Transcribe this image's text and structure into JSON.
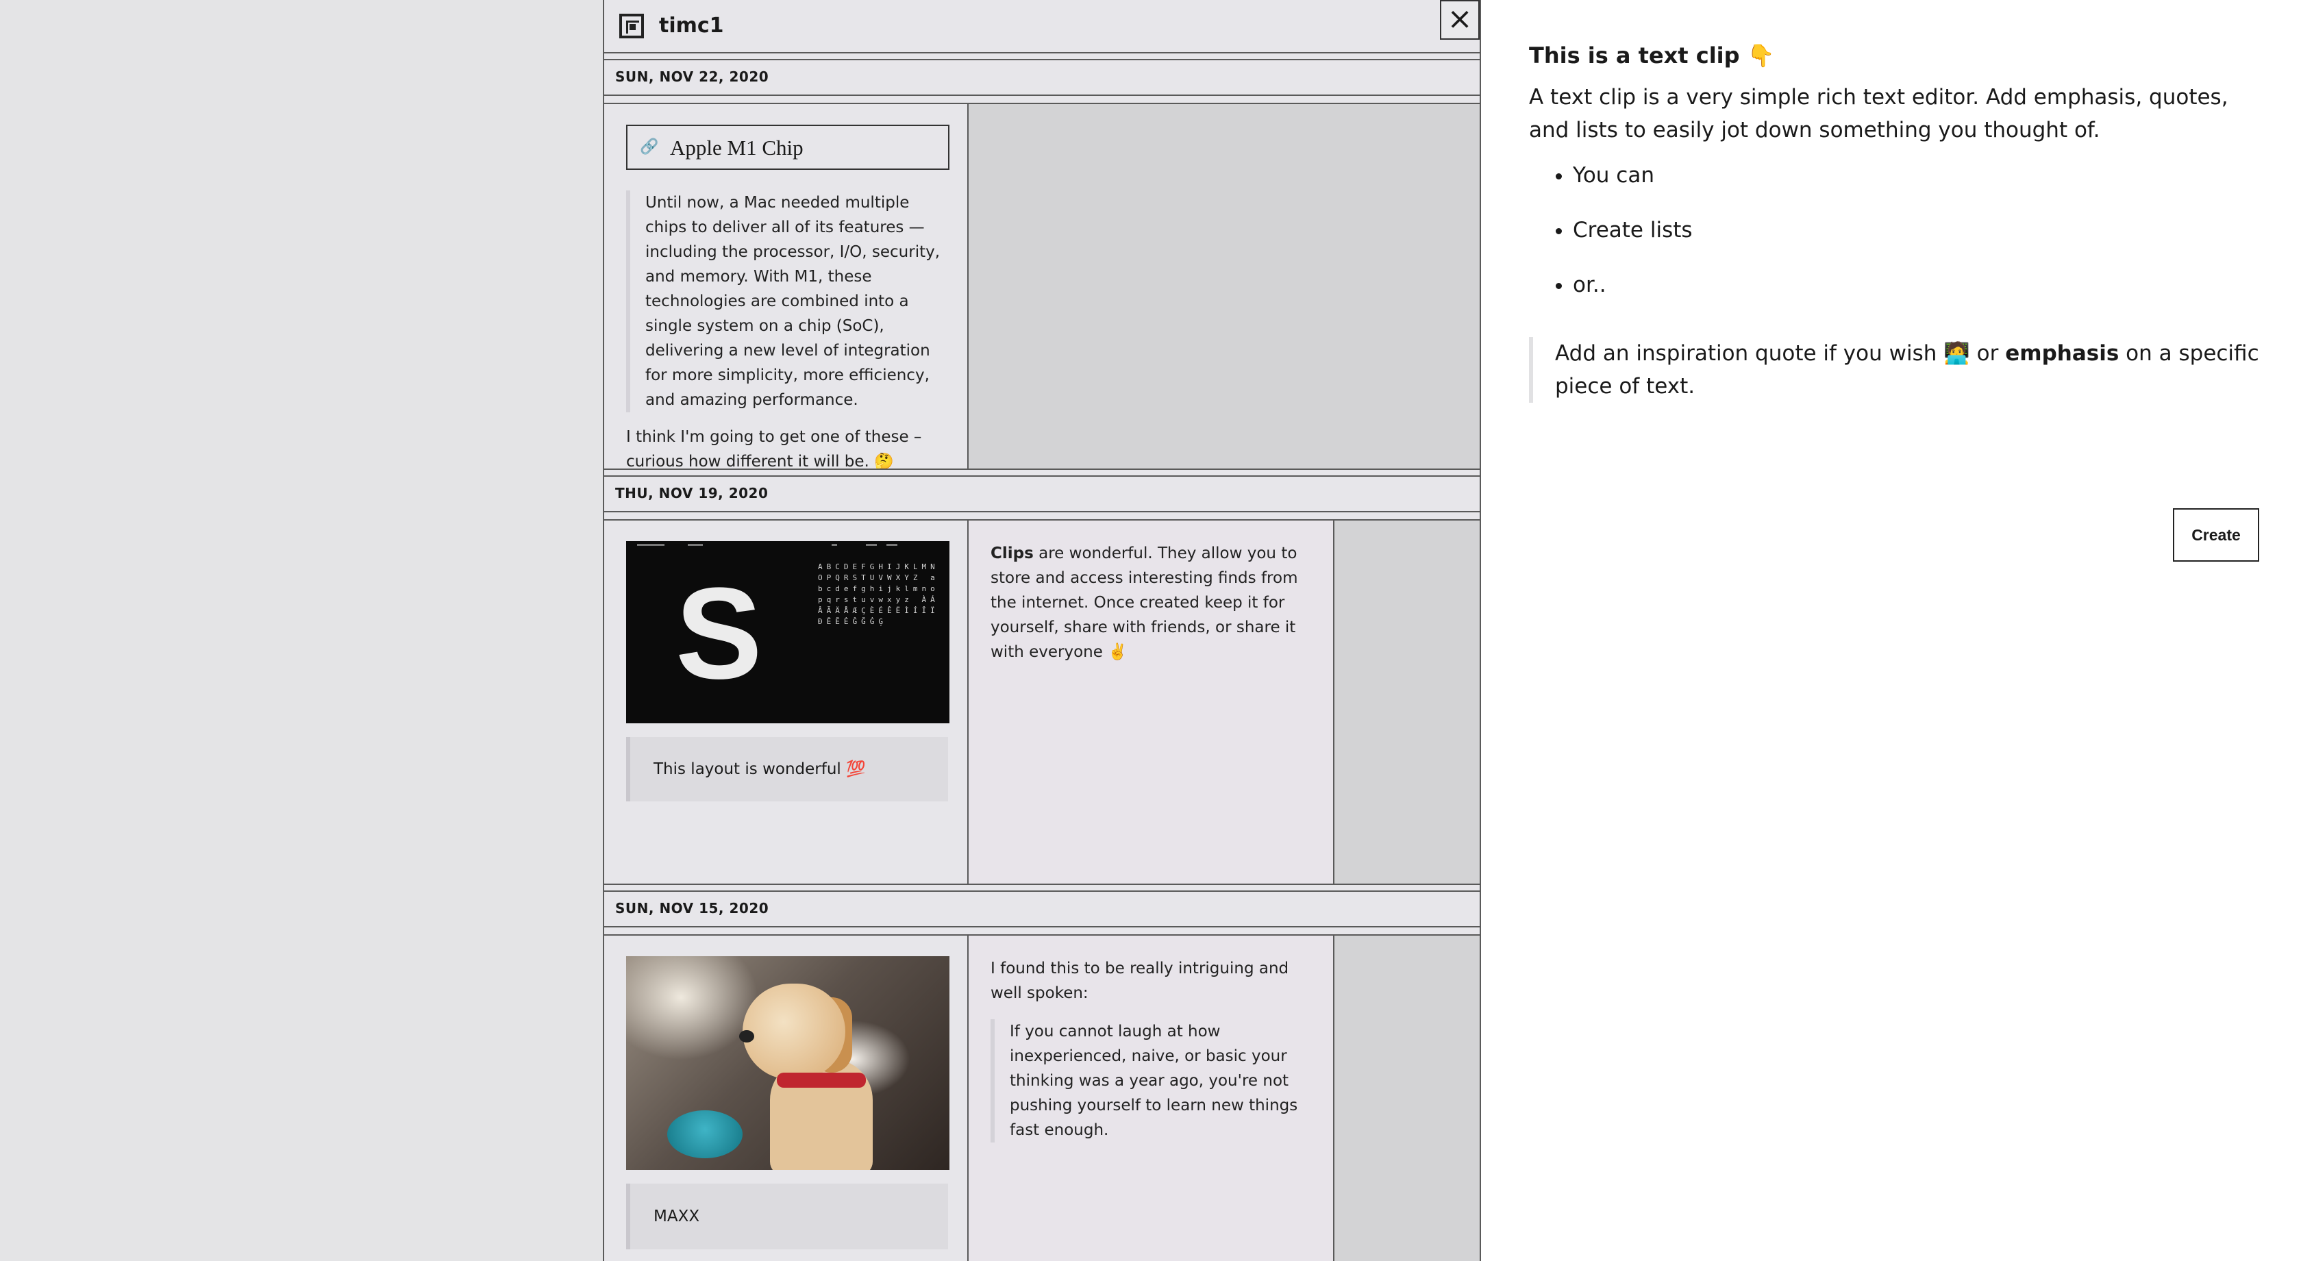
{
  "header": {
    "username": "timc1",
    "close_glyph": "×"
  },
  "feed": [
    {
      "date": "SUN, NOV 22, 2020",
      "link_title": "Apple M1 Chip",
      "link_icon": "🔗",
      "quote": "Until now, a Mac needed multiple chips to deliver all of its features — including the processor, I/O, security, and memory. With M1, these technologies are combined into a single system on a chip (SoC), delivering a new level of integration for more simplicity, more efficiency, and amazing performance.",
      "comment": "I think I'm going to get one of these – curious how different it will be. 🤔"
    },
    {
      "date": "THU, NOV 19, 2020",
      "image_letter": "S",
      "image_glyphs": "ABCDEFGHIJKLMNOPQRSTUVWXYZ abcdefghijklmnopqrstuvwxyz ÀÁÂÃÄÅÆÇÈÉÊËÌÍÎÏĐĒĔĖĜĞĠĢ",
      "note": "This layout is wonderful 💯",
      "clip_bold": "Clips",
      "clip_text": " are wonderful. They allow you to store and access interesting finds from the internet. Once created keep it for yourself, share with friends, or share it with everyone ✌️"
    },
    {
      "date": "SUN, NOV 15, 2020",
      "note": "MAXX",
      "intro": "I found this to be really intriguing and well spoken:",
      "quote": "If you cannot laugh at how inexperienced, naive, or basic your thinking was a year ago, you're not pushing yourself to learn new things fast enough."
    }
  ],
  "editor": {
    "title": "This is a text clip 👇",
    "intro": "A text clip is a very simple rich text editor. Add emphasis, quotes, and lists to easily jot down something you thought of.",
    "list": [
      "You can",
      "Create lists",
      "or.."
    ],
    "quote_a": "Add an inspiration quote if you wish 🧑‍💻 or ",
    "quote_bold": "emphasis",
    "quote_b": " on a specific piece of text.",
    "create_label": "Create"
  },
  "colors": {
    "background": "#e4e4e6",
    "panel": "#ffffff",
    "border": "#5a5a5a",
    "placeholder": "#d3d3d5"
  }
}
